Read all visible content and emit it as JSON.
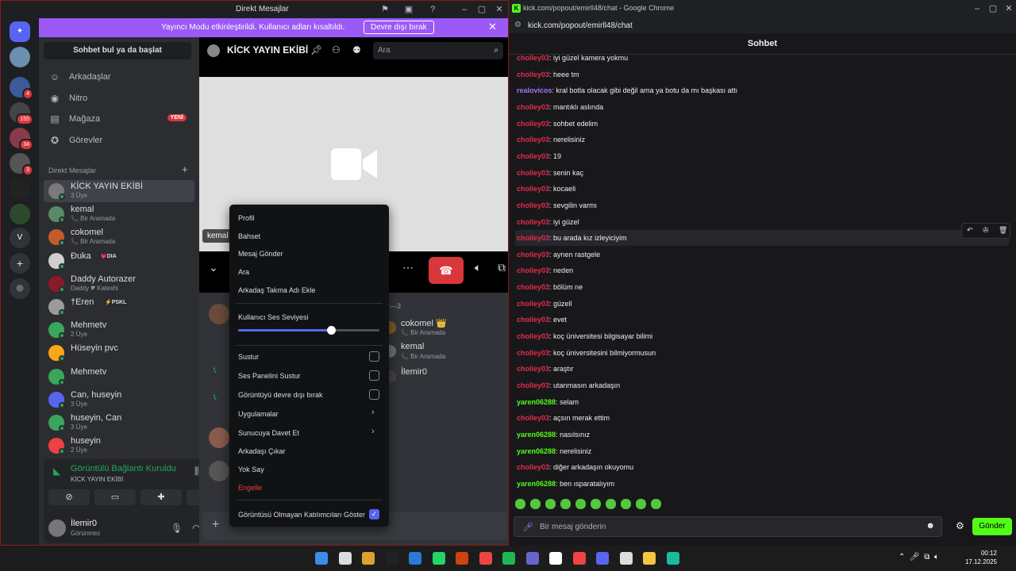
{
  "discord": {
    "title": "Direkt Mesajlar",
    "streamer_msg": "Yayıncı Modu etkinleştirildi. Kullanıcı adları kısaltıldı.",
    "streamer_btn": "Devre dışı bırak",
    "rail_badges": [
      "4",
      "155",
      "34",
      "3"
    ],
    "rail_v": "V",
    "find": "Sohbet bul ya da başlat",
    "nav": [
      {
        "icon": "friends-icon",
        "label": "Arkadaşlar"
      },
      {
        "icon": "nitro-icon",
        "label": "Nitro"
      },
      {
        "icon": "store-icon",
        "label": "Mağaza",
        "badge": "YENİ"
      },
      {
        "icon": "quests-icon",
        "label": "Görevler"
      }
    ],
    "dm_header": "Direkt Mesajlar",
    "dms": [
      {
        "name": "KİCK YAYIN EKİBİ",
        "sub": "3 Üye",
        "color": "#7a7a7a"
      },
      {
        "name": "kemal",
        "sub": "📞 Bir Aramada",
        "color": "#5a8a6a"
      },
      {
        "name": "cokomel",
        "sub": "📞 Bir Aramada",
        "color": "#c45a2a"
      },
      {
        "name": "Đuka",
        "sub": "",
        "tag": "💗DIA",
        "color": "#cfcfcf"
      },
      {
        "name": "Daddy Autorazer",
        "sub": "Daddy 🎔 Kateshi",
        "color": "#8a1a2a"
      },
      {
        "name": "†Eren",
        "sub": "",
        "tag": "⚡PSKL",
        "color": "#9a9a9a"
      },
      {
        "name": "Mehmetv",
        "sub": "2 Üye",
        "color": "#3ba55c"
      },
      {
        "name": "Hüseyin pvc",
        "sub": "",
        "color": "#faa61a"
      },
      {
        "name": "Mehmetv",
        "sub": "",
        "color": "#3ba55c"
      },
      {
        "name": "Can, huseyin",
        "sub": "3 Üye",
        "color": "#5865f2"
      },
      {
        "name": "huseyin, Can",
        "sub": "3 Üye",
        "color": "#3ba55c"
      },
      {
        "name": "huseyin",
        "sub": "2 Üye",
        "color": "#ed4245"
      }
    ],
    "voice": {
      "title": "Görüntülü Bağlantı Kuruldu",
      "sub": "KİCK YAYIN EKİBİ"
    },
    "user": {
      "name": "İlemir0",
      "status": "Görünmez"
    },
    "group_title": "KİCK YAYIN EKİBİ",
    "search_ph": "Ara",
    "video_tag": "kemal",
    "members_header": "ler—3",
    "members": [
      {
        "name": "cokomel 👑",
        "sub": "📞 Bir Aramada"
      },
      {
        "name": "kemal",
        "sub": "📞 Bir Aramada"
      },
      {
        "name": "İlemir0",
        "sub": ""
      }
    ],
    "menu": {
      "items1": [
        "Profil",
        "Bahset",
        "Mesaj Gönder",
        "Ara",
        "Arkadaş Takma Adı Ekle"
      ],
      "volume_label": "Kullanıcı Ses Seviyesi",
      "volume": 0.66,
      "checks": [
        "Sustur",
        "Ses Panelini Sustur",
        "Görüntüyü devre dışı bırak"
      ],
      "subs": [
        "Uygulamalar",
        "Sunucuya Davet Et"
      ],
      "items2": [
        "Arkadaşı Çıkar",
        "Yok Say"
      ],
      "danger": "Engelle",
      "bottom_check": "Görüntüsü Olmayan Katılımcıları Göster"
    }
  },
  "chrome": {
    "title": "kick.com/popout/emirll48/chat - Google Chrome",
    "url": "kick.com/popout/emirll48/chat",
    "header": "Sohbet",
    "colors": {
      "cholley": "#e32c4a",
      "realovicos": "#a970ff",
      "yaren": "#53fc18"
    },
    "messages": [
      {
        "u": "cholley03",
        "c": "cholley",
        "t": "iyi güzel kamera yokmu"
      },
      {
        "u": "cholley03",
        "c": "cholley",
        "t": "heee tm"
      },
      {
        "u": "realovicos",
        "c": "realovicos",
        "t": "kral botla olacak gibi değil ama ya botu da mı başkası attı"
      },
      {
        "u": "cholley03",
        "c": "cholley",
        "t": "mantıklı aslında"
      },
      {
        "u": "cholley03",
        "c": "cholley",
        "t": "sohbet edelim"
      },
      {
        "u": "cholley03",
        "c": "cholley",
        "t": "nerelisiniz"
      },
      {
        "u": "cholley03",
        "c": "cholley",
        "t": "19"
      },
      {
        "u": "cholley03",
        "c": "cholley",
        "t": "senin kaç"
      },
      {
        "u": "cholley03",
        "c": "cholley",
        "t": "kocaeli"
      },
      {
        "u": "cholley03",
        "c": "cholley",
        "t": "sevgilin varmı"
      },
      {
        "u": "cholley03",
        "c": "cholley",
        "t": "iyi güzel"
      },
      {
        "u": "cholley03",
        "c": "cholley",
        "t": "bu arada kız izleyiciyim"
      },
      {
        "u": "cholley03",
        "c": "cholley",
        "t": "aynen rastgele"
      },
      {
        "u": "cholley03",
        "c": "cholley",
        "t": "neden"
      },
      {
        "u": "cholley03",
        "c": "cholley",
        "t": "bölüm ne"
      },
      {
        "u": "cholley03",
        "c": "cholley",
        "t": "güzell"
      },
      {
        "u": "cholley03",
        "c": "cholley",
        "t": "evet"
      },
      {
        "u": "cholley03",
        "c": "cholley",
        "t": "koç üniversitesi bilgisayar bilimi"
      },
      {
        "u": "cholley03",
        "c": "cholley",
        "t": "koç üniversitesini bilmiyormusun"
      },
      {
        "u": "cholley03",
        "c": "cholley",
        "t": "araştır"
      },
      {
        "u": "cholley03",
        "c": "cholley",
        "t": "utanmasın arkadaşın"
      },
      {
        "u": "yaren06288",
        "c": "yaren",
        "t": "selam"
      },
      {
        "u": "cholley03",
        "c": "cholley",
        "t": "açsın merak ettim"
      },
      {
        "u": "yaren06288",
        "c": "yaren",
        "t": "nasılsınız"
      },
      {
        "u": "yaren06288",
        "c": "yaren",
        "t": "nerelisiniz"
      },
      {
        "u": "cholley03",
        "c": "cholley",
        "t": "diğer arkadaşın okuyomu"
      },
      {
        "u": "yaren06288",
        "c": "yaren",
        "t": "ben ısparatalıyım"
      }
    ],
    "input_ph": "Bir mesaj gönderin",
    "send": "Gönder"
  },
  "taskbar": {
    "time": "00:12",
    "date": "17.12.2025"
  }
}
